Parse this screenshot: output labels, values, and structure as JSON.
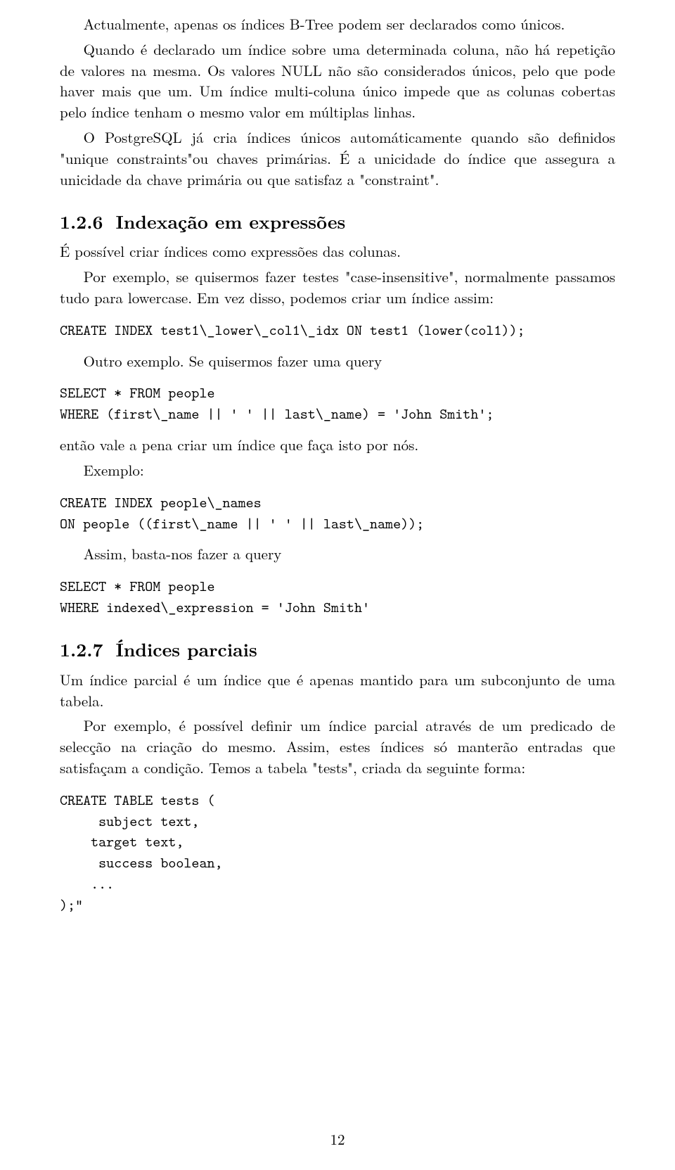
{
  "paragraphs": {
    "p1": "Actualmente, apenas os índices B-Tree podem ser declarados como únicos.",
    "p2": "Quando é declarado um índice sobre uma determinada coluna, não há repetição de valores na mesma. Os valores NULL não são considerados únicos, pelo que pode haver mais que um. Um índice multi-coluna único impede que as colunas cobertas pelo índice tenham o mesmo valor em múltiplas linhas.",
    "p3": "O PostgreSQL já cria índices únicos automáticamente quando são definidos \"unique constraints\"ou chaves primárias. É a unicidade do índice que assegura a unicidade da chave primária ou que satisfaz a \"constraint\".",
    "p4": "É possível criar índices como expressões das colunas.",
    "p5": "Por exemplo, se quisermos fazer testes \"case-insensitive\", normalmente passamos tudo para lowercase. Em vez disso, podemos criar um índice assim:",
    "p6": "Outro exemplo. Se quisermos fazer uma query",
    "p7": "então vale a pena criar um índice que faça isto por nós.",
    "p8": "Exemplo:",
    "p9": "Assim, basta-nos fazer a query",
    "p10": "Um índice parcial é um índice que é apenas mantido para um subconjunto de uma tabela.",
    "p11": "Por exemplo, é possível definir um índice parcial através de um predicado de selecção na criação do mesmo. Assim, estes índices só manterão entradas que satisfaçam a condição. Temos a tabela \"tests\", criada da seguinte forma:"
  },
  "sections": {
    "s126": {
      "num": "1.2.6",
      "title": "Indexação em expressões"
    },
    "s127": {
      "num": "1.2.7",
      "title": "Índices parciais"
    }
  },
  "code": {
    "c1": "CREATE INDEX test1\\_lower\\_col1\\_idx ON test1 (lower(col1));",
    "c2": "SELECT * FROM people\nWHERE (first\\_name || ' ' || last\\_name) = 'John Smith';",
    "c3": "CREATE INDEX people\\_names\nON people ((first\\_name || ' ' || last\\_name));",
    "c4": "SELECT * FROM people\nWHERE indexed\\_expression = 'John Smith'",
    "c5": "CREATE TABLE tests (\n     subject text,\n    target text,\n     success boolean,\n    ...\n);\""
  },
  "page_number": "12"
}
